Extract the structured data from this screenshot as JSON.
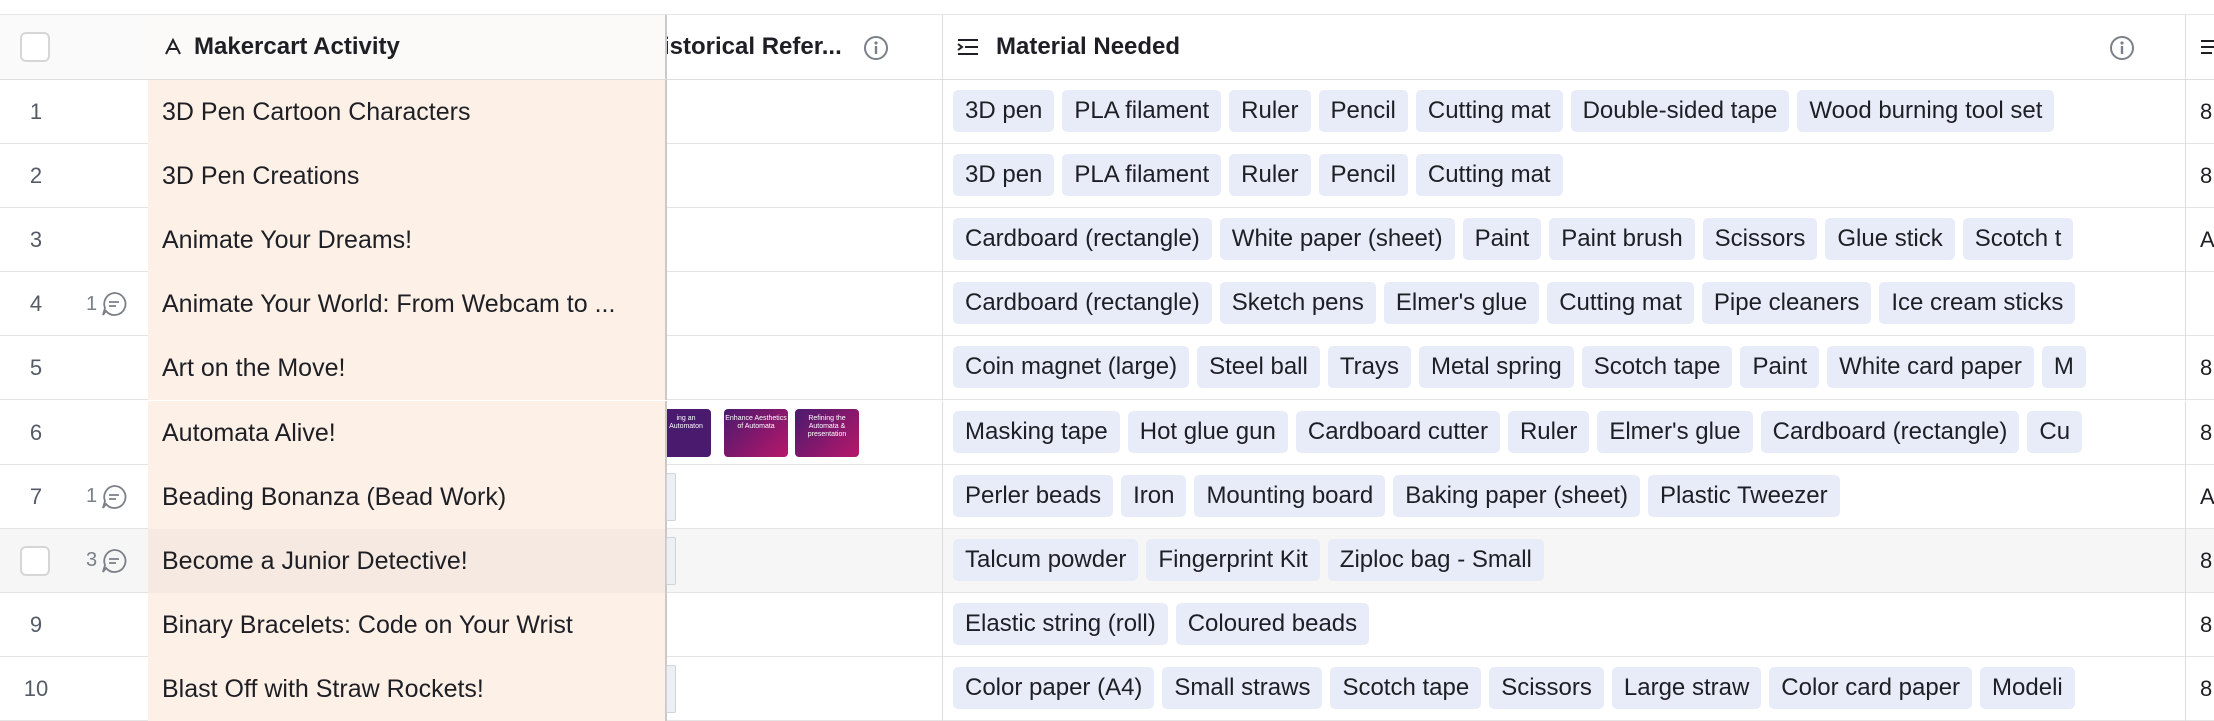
{
  "columns": {
    "primary": "Makercart Activity",
    "historical": "istorical Refer...",
    "material": "Material Needed"
  },
  "next_column_values": [
    "8",
    "8",
    "A",
    "",
    "8",
    "8",
    "A",
    "8",
    "8",
    "8"
  ],
  "rows": [
    {
      "num": "1",
      "comments": "",
      "activity": "3D Pen Cartoon Characters",
      "materials": [
        "3D pen",
        "PLA filament",
        "Ruler",
        "Pencil",
        "Cutting mat",
        "Double-sided tape",
        "Wood burning tool set"
      ]
    },
    {
      "num": "2",
      "comments": "",
      "activity": "3D Pen Creations",
      "materials": [
        "3D pen",
        "PLA filament",
        "Ruler",
        "Pencil",
        "Cutting mat"
      ]
    },
    {
      "num": "3",
      "comments": "",
      "activity": "Animate Your Dreams!",
      "materials": [
        "Cardboard (rectangle)",
        "White paper (sheet)",
        "Paint",
        "Paint brush",
        "Scissors",
        "Glue stick",
        "Scotch t"
      ]
    },
    {
      "num": "4",
      "comments": "1",
      "activity": "Animate Your World: From Webcam to ...",
      "materials": [
        "Cardboard (rectangle)",
        "Sketch pens",
        "Elmer's glue",
        "Cutting mat",
        "Pipe cleaners",
        "Ice cream sticks"
      ]
    },
    {
      "num": "5",
      "comments": "",
      "activity": "Art on the Move!",
      "materials": [
        "Coin magnet (large)",
        "Steel ball",
        "Trays",
        "Metal spring",
        "Scotch tape",
        "Paint",
        "White card paper",
        "M"
      ]
    },
    {
      "num": "6",
      "comments": "",
      "activity": "Automata Alive!",
      "materials": [
        "Masking tape",
        "Hot glue gun",
        "Cardboard cutter",
        "Ruler",
        "Elmer's glue",
        "Cardboard (rectangle)",
        "Cu"
      ],
      "thumbs": [
        "ing an Automaton",
        "Enhance Aesthetics of Automata",
        "Refining the Automata & presentation"
      ]
    },
    {
      "num": "7",
      "comments": "1",
      "activity": "Beading Bonanza (Bead Work)",
      "materials": [
        "Perler beads",
        "Iron",
        "Mounting board",
        "Baking paper (sheet)",
        "Plastic Tweezer"
      ]
    },
    {
      "num": "",
      "comments": "3",
      "activity": "Become a Junior Detective!",
      "materials": [
        "Talcum powder",
        "Fingerprint Kit",
        "Ziploc bag - Small"
      ]
    },
    {
      "num": "9",
      "comments": "",
      "activity": "Binary Bracelets: Code on Your Wrist",
      "materials": [
        "Elastic string (roll)",
        "Coloured beads"
      ]
    },
    {
      "num": "10",
      "comments": "",
      "activity": "Blast Off with Straw Rockets!",
      "materials": [
        "Color paper (A4)",
        "Small straws",
        "Scotch tape",
        "Scissors",
        "Large straw",
        "Color card paper",
        "Modeli"
      ]
    }
  ],
  "icons": {
    "primary_field": "primary-field-icon",
    "info": "info-icon",
    "multiselect": "multiple-select-icon",
    "comment": "comment-icon"
  },
  "colors": {
    "primary_column_bg": "#fdf0e7",
    "tag_bg": "#e8ecf8",
    "thumb_bg_1": "#4a1a6e",
    "thumb_bg_2": "#b8176a"
  }
}
